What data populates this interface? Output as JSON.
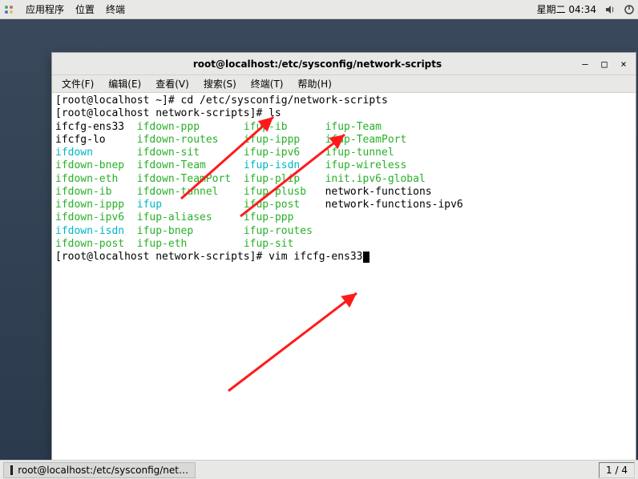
{
  "topbar": {
    "menu": [
      "应用程序",
      "位置",
      "终端"
    ],
    "datetime": "星期二 04:34"
  },
  "window": {
    "title": "root@localhost:/etc/sysconfig/network-scripts",
    "menu": [
      "文件(F)",
      "编辑(E)",
      "查看(V)",
      "搜索(S)",
      "终端(T)",
      "帮助(H)"
    ],
    "controls": {
      "min": "—",
      "max": "□",
      "close": "×"
    }
  },
  "terminal": {
    "prompt1_pre": "[root@localhost ~]# ",
    "cmd1": "cd /etc/sysconfig/network-scripts",
    "prompt2_pre": "[root@localhost network-scripts]# ",
    "cmd2": "ls",
    "ls": {
      "col1": [
        {
          "t": "ifcfg-ens33",
          "c": "black"
        },
        {
          "t": "ifcfg-lo",
          "c": "black"
        },
        {
          "t": "ifdown",
          "c": "cyan"
        },
        {
          "t": "ifdown-bnep",
          "c": "green"
        },
        {
          "t": "ifdown-eth",
          "c": "green"
        },
        {
          "t": "ifdown-ib",
          "c": "green"
        },
        {
          "t": "ifdown-ippp",
          "c": "green"
        },
        {
          "t": "ifdown-ipv6",
          "c": "green"
        },
        {
          "t": "ifdown-isdn",
          "c": "cyan"
        },
        {
          "t": "ifdown-post",
          "c": "green"
        }
      ],
      "col2": [
        {
          "t": "ifdown-ppp",
          "c": "green"
        },
        {
          "t": "ifdown-routes",
          "c": "green"
        },
        {
          "t": "ifdown-sit",
          "c": "green"
        },
        {
          "t": "ifdown-Team",
          "c": "green"
        },
        {
          "t": "ifdown-TeamPort",
          "c": "green"
        },
        {
          "t": "ifdown-tunnel",
          "c": "green"
        },
        {
          "t": "ifup",
          "c": "cyan"
        },
        {
          "t": "ifup-aliases",
          "c": "green"
        },
        {
          "t": "ifup-bnep",
          "c": "green"
        },
        {
          "t": "ifup-eth",
          "c": "green"
        }
      ],
      "col3": [
        {
          "t": "ifup-ib",
          "c": "green"
        },
        {
          "t": "ifup-ippp",
          "c": "green"
        },
        {
          "t": "ifup-ipv6",
          "c": "green"
        },
        {
          "t": "ifup-isdn",
          "c": "cyan"
        },
        {
          "t": "ifup-plip",
          "c": "green"
        },
        {
          "t": "ifup-plusb",
          "c": "green"
        },
        {
          "t": "ifup-post",
          "c": "green"
        },
        {
          "t": "ifup-ppp",
          "c": "green"
        },
        {
          "t": "ifup-routes",
          "c": "green"
        },
        {
          "t": "ifup-sit",
          "c": "green"
        }
      ],
      "col4": [
        {
          "t": "ifup-Team",
          "c": "green"
        },
        {
          "t": "ifup-TeamPort",
          "c": "green"
        },
        {
          "t": "ifup-tunnel",
          "c": "green"
        },
        {
          "t": "ifup-wireless",
          "c": "green"
        },
        {
          "t": "init.ipv6-global",
          "c": "green"
        },
        {
          "t": "network-functions",
          "c": "black"
        },
        {
          "t": "network-functions-ipv6",
          "c": "black"
        },
        {
          "t": "",
          "c": "black"
        },
        {
          "t": "",
          "c": "black"
        },
        {
          "t": "",
          "c": "black"
        }
      ],
      "w1": 13,
      "w2": 17,
      "w3": 13
    },
    "prompt3_pre": "[root@localhost network-scripts]# ",
    "cmd3": "vim ifcfg-ens33"
  },
  "taskbar": {
    "entry": "root@localhost:/etc/sysconfig/net…",
    "workspace": "1 / 4"
  }
}
